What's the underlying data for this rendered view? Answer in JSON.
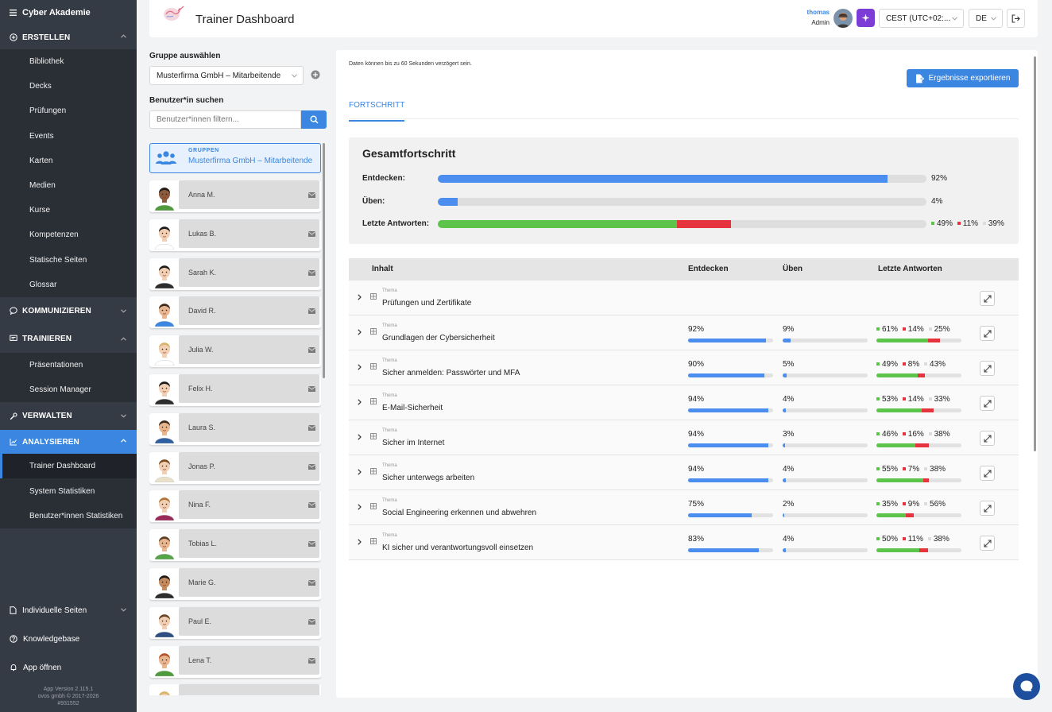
{
  "colors": {
    "accent": "#3a86e0",
    "sidebar": "#353b44",
    "progress": "#4c8df0",
    "correct": "#5cc44a",
    "wrong": "#e5343e",
    "unanswered": "#dddddd"
  },
  "sidebar": {
    "brand": "Cyber Akademie",
    "sections": {
      "erstellen": {
        "label": "ERSTELLEN",
        "items": [
          "Bibliothek",
          "Decks",
          "Prüfungen",
          "Events",
          "Karten",
          "Medien",
          "Kurse",
          "Kompetenzen",
          "Statische Seiten",
          "Glossar"
        ]
      },
      "kommunizieren": {
        "label": "KOMMUNIZIEREN"
      },
      "trainieren": {
        "label": "TRAINIEREN",
        "items": [
          "Präsentationen",
          "Session Manager"
        ]
      },
      "verwalten": {
        "label": "VERWALTEN"
      },
      "analysieren": {
        "label": "ANALYSIEREN",
        "items": [
          "Trainer Dashboard",
          "System Statistiken",
          "Benutzer*innen Statistiken"
        ],
        "active_item": "Trainer Dashboard"
      }
    },
    "bottom_links": [
      "Individuelle Seiten",
      "Knowledgebase",
      "App öffnen"
    ],
    "footer": {
      "version": "App Version 2.115.1",
      "copyright": "ovos gmbh © 2017-2026",
      "build": "#931552"
    }
  },
  "header": {
    "title": "Trainer Dashboard",
    "user_name": "thomas",
    "user_role": "Admin",
    "timezone": "CEST (UTC+02:...",
    "language": "DE"
  },
  "left_panel": {
    "group_label": "Gruppe auswählen",
    "group_value": "Musterfirma GmbH – Mitarbeitende",
    "search_label": "Benutzer*in suchen",
    "search_placeholder": "Benutzer*innen filtern...",
    "group_card": {
      "kind": "GRUPPEN",
      "name": "Musterfirma GmbH – Mitarbeitende"
    },
    "users": [
      "Anna M.",
      "Lukas B.",
      "Sarah K.",
      "David R.",
      "Julia W.",
      "Felix H.",
      "Laura S.",
      "Jonas P.",
      "Nina F.",
      "Tobias L.",
      "Marie G.",
      "Paul E.",
      "Lena T.",
      ""
    ]
  },
  "main": {
    "note": "Daten können bis zu 60 Sekunden verzögert sein.",
    "export_label": "Ergebnisse exportieren",
    "tab": "FORTSCHRITT",
    "overall": {
      "title": "Gesamtfortschritt",
      "discover": {
        "label": "Entdecken:",
        "value": 92,
        "text": "92%"
      },
      "practice": {
        "label": "Üben:",
        "value": 4,
        "text": "4%"
      },
      "answers": {
        "label": "Letzte Antworten:",
        "correct": 49,
        "wrong": 11,
        "open": 39,
        "correct_text": "49%",
        "wrong_text": "11%",
        "open_text": "39%"
      }
    },
    "table": {
      "headers": {
        "content": "Inhalt",
        "discover": "Entdecken",
        "practice": "Üben",
        "answers": "Letzte Antworten"
      },
      "rows": [
        {
          "kind": "Thema",
          "title": "Prüfungen und Zertifikate",
          "discover": null,
          "practice": null,
          "correct": null,
          "wrong": null,
          "open": null
        },
        {
          "kind": "Thema",
          "title": "Grundlagen der Cybersicherheit",
          "discover": 92,
          "practice": 9,
          "correct": 61,
          "wrong": 14,
          "open": 25
        },
        {
          "kind": "Thema",
          "title": "Sicher anmelden: Passwörter und MFA",
          "discover": 90,
          "practice": 5,
          "correct": 49,
          "wrong": 8,
          "open": 43
        },
        {
          "kind": "Thema",
          "title": "E-Mail-Sicherheit",
          "discover": 94,
          "practice": 4,
          "correct": 53,
          "wrong": 14,
          "open": 33
        },
        {
          "kind": "Thema",
          "title": "Sicher im Internet",
          "discover": 94,
          "practice": 3,
          "correct": 46,
          "wrong": 16,
          "open": 38
        },
        {
          "kind": "Thema",
          "title": "Sicher unterwegs arbeiten",
          "discover": 94,
          "practice": 4,
          "correct": 55,
          "wrong": 7,
          "open": 38
        },
        {
          "kind": "Thema",
          "title": "Social Engineering erkennen und abwehren",
          "discover": 75,
          "practice": 2,
          "correct": 35,
          "wrong": 9,
          "open": 56
        },
        {
          "kind": "Thema",
          "title": "KI sicher und verantwortungsvoll einsetzen",
          "discover": 83,
          "practice": 4,
          "correct": 50,
          "wrong": 11,
          "open": 38
        }
      ]
    }
  }
}
